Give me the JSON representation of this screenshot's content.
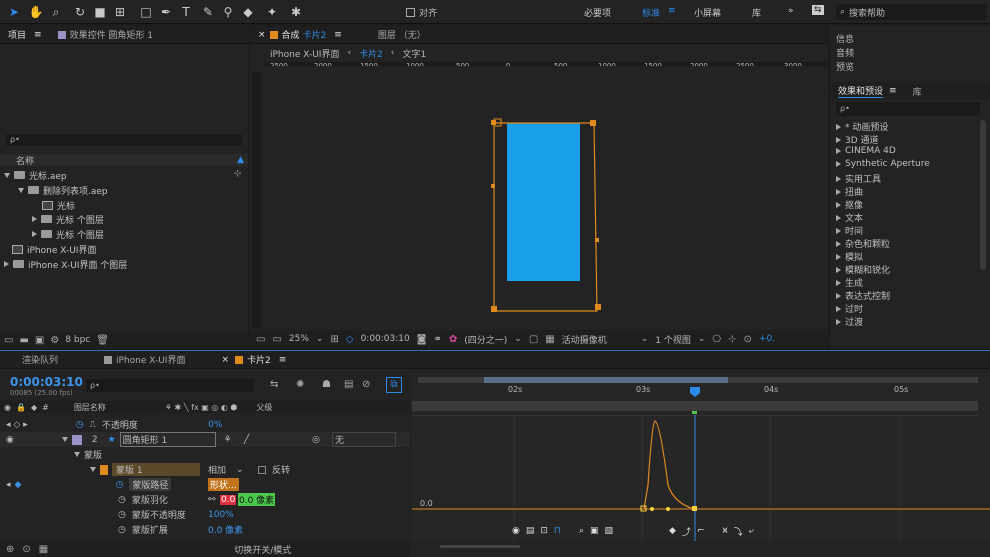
{
  "toolbar": {
    "snap_label": "对齐",
    "workspaces": [
      "必要项",
      "标准",
      "小屏幕",
      "库"
    ],
    "active_workspace": "标准",
    "search_placeholder": "搜索帮助"
  },
  "project": {
    "tabs": [
      "项目",
      "效果控件 圆角矩形 1"
    ],
    "search_placeholder": "ρ•",
    "column_name": "名称",
    "items": [
      {
        "label": "光标.aep",
        "type": "folder",
        "indent": 0
      },
      {
        "label": "删除列表项.aep",
        "type": "folder",
        "indent": 1
      },
      {
        "label": "光标",
        "type": "comp",
        "indent": 2
      },
      {
        "label": "光标 个图层",
        "type": "folder",
        "indent": 2
      },
      {
        "label": "光标 个图层",
        "type": "folder",
        "indent": 2
      },
      {
        "label": "iPhone X-UI界面",
        "type": "comp",
        "indent": 0
      },
      {
        "label": "iPhone X-UI界面 个图层",
        "type": "folder",
        "indent": 0
      }
    ],
    "bit_depth": "8 bpc"
  },
  "composition": {
    "tab_comp_prefix": "合成",
    "tab_comp_name": "卡片2",
    "tab_layer": "图层 （无）",
    "breadcrumbs": [
      "iPhone X-UI界面",
      "卡片2",
      "文字1"
    ],
    "ruler_labels": [
      "2500",
      "2000",
      "1500",
      "1000",
      "500",
      "0",
      "500",
      "1000",
      "1500",
      "2000",
      "2500",
      "3000"
    ],
    "zoom": "25%",
    "timecode": "0:00:03:10",
    "resolution": "(四分之一)",
    "camera": "活动摄像机",
    "views": "1 个视图",
    "exposure": "+0.",
    "rect_color": "#1aa0ea",
    "mask_color": "#e08a1e"
  },
  "effects": {
    "tabs": [
      "信息",
      "音频",
      "预览"
    ],
    "panel_title": "效果和预设",
    "panel_tab2": "库",
    "search_placeholder": "ρ•",
    "items": [
      "* 动画预设",
      "3D 通道",
      "CINEMA 4D",
      "Synthetic Aperture",
      "实用工具",
      "扭曲",
      "抠像",
      "文本",
      "时间",
      "杂色和颗粒",
      "模拟",
      "模糊和锐化",
      "生成",
      "表达式控制",
      "过时",
      "过渡"
    ]
  },
  "timeline": {
    "tabs": [
      "渲染队列",
      "iPhone X-UI界面",
      "卡片2"
    ],
    "timecode": "0:00:03:10",
    "frame_info": "00085 (25.00 fps)",
    "search_placeholder": "ρ•",
    "col_layer_name": "图层名称",
    "col_parent": "父级",
    "ruler_labels": [
      "02s",
      "03s",
      "04s",
      "05s"
    ],
    "graph_value": "0.0",
    "rows": {
      "opacity_label": "不透明度",
      "opacity_value": "0%",
      "layer_num": "2",
      "layer_name": "圆角矩形 1",
      "parent_value": "无",
      "masks_label": "蒙版",
      "mask1_label": "蒙版 1",
      "mask_mode": "相加",
      "invert_label": "反转",
      "mask_path_label": "蒙版路径",
      "mask_path_value": "形状...",
      "feather_label": "蒙版羽化",
      "feather_x": "0.0",
      "feather_y": "0.0 像素",
      "mask_opacity_label": "蒙版不透明度",
      "mask_opacity_value": "100%",
      "expansion_label": "蒙版扩展",
      "expansion_value": "0.0 像素"
    },
    "toggle_label": "切换开关/模式"
  }
}
